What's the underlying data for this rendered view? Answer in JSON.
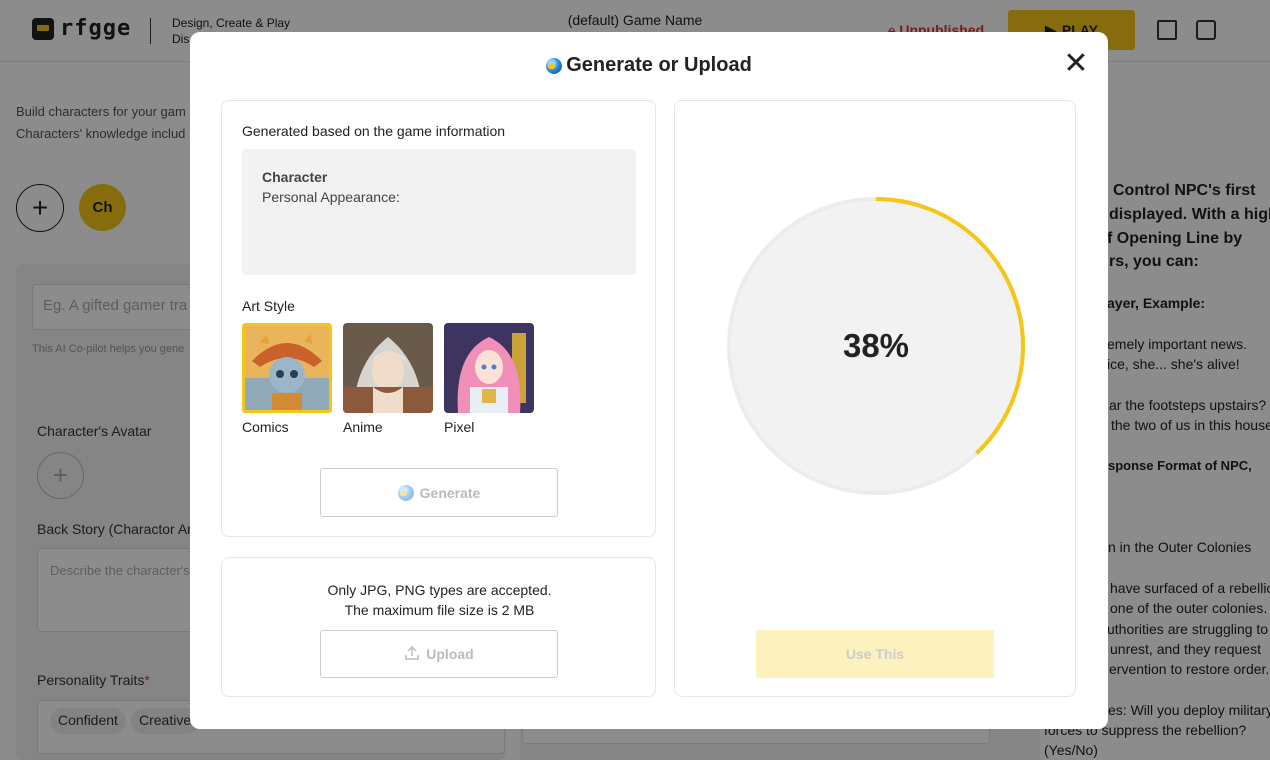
{
  "header": {
    "logo_text": "rfgge",
    "tagline_line1": "Design, Create & Play",
    "tagline_line2": "Dis",
    "game_name": "(default) Game Name",
    "status": "Unpublished",
    "play_label": "PLAY"
  },
  "background": {
    "intro_line1": "Build characters for your gam",
    "intro_line2": "Characters' knowledge includ",
    "character_chip": "Ch",
    "prompt_placeholder": "Eg. A gifted gamer tra",
    "copilot_hint": "This AI Co-pilot helps you gene",
    "avatar_label": "Character's Avatar",
    "backstory_label": "Back Story (Charactor Arc",
    "backstory_placeholder": "Describe the character's",
    "traits_label": "Personality Traits",
    "traits": [
      "Confident",
      "Creative"
    ],
    "right_lines": [
      "Control NPC's first",
      "displayed. With a high",
      "f Opening Line by",
      "rs, you can:",
      "ayer, Example:",
      "emely important news.",
      "ice, she... she's alive!",
      "ar the footsteps upstairs? Bu",
      "the two of us in this house.",
      "sponse Format of NPC,",
      "n in the Outer Colonies",
      "have surfaced of a rebellion",
      "one of the outer colonies.",
      "uthorities are struggling to",
      "unrest, and they request",
      "ervention to restore order.",
      "es: Will you deploy military",
      "forces to suppress the rebellion?",
      "(Yes/No)"
    ]
  },
  "modal": {
    "title": "Generate or Upload",
    "generate_section": {
      "heading": "Generated based on the game information",
      "desc_title": "Character",
      "desc_line": "Personal Appearance:",
      "art_style_label": "Art Style",
      "styles": [
        {
          "name": "Comics",
          "selected": true
        },
        {
          "name": "Anime",
          "selected": false
        },
        {
          "name": "Pixel",
          "selected": false
        }
      ],
      "generate_label": "Generate"
    },
    "upload_section": {
      "note_line1": "Only JPG, PNG types are accepted.",
      "note_line2": "The maximum file size is 2 MB",
      "upload_label": "Upload"
    },
    "preview": {
      "progress_text": "38%",
      "progress_value": 0.38,
      "use_label": "Use This"
    }
  },
  "colors": {
    "accent": "#f5c518",
    "danger": "#dd3333"
  }
}
